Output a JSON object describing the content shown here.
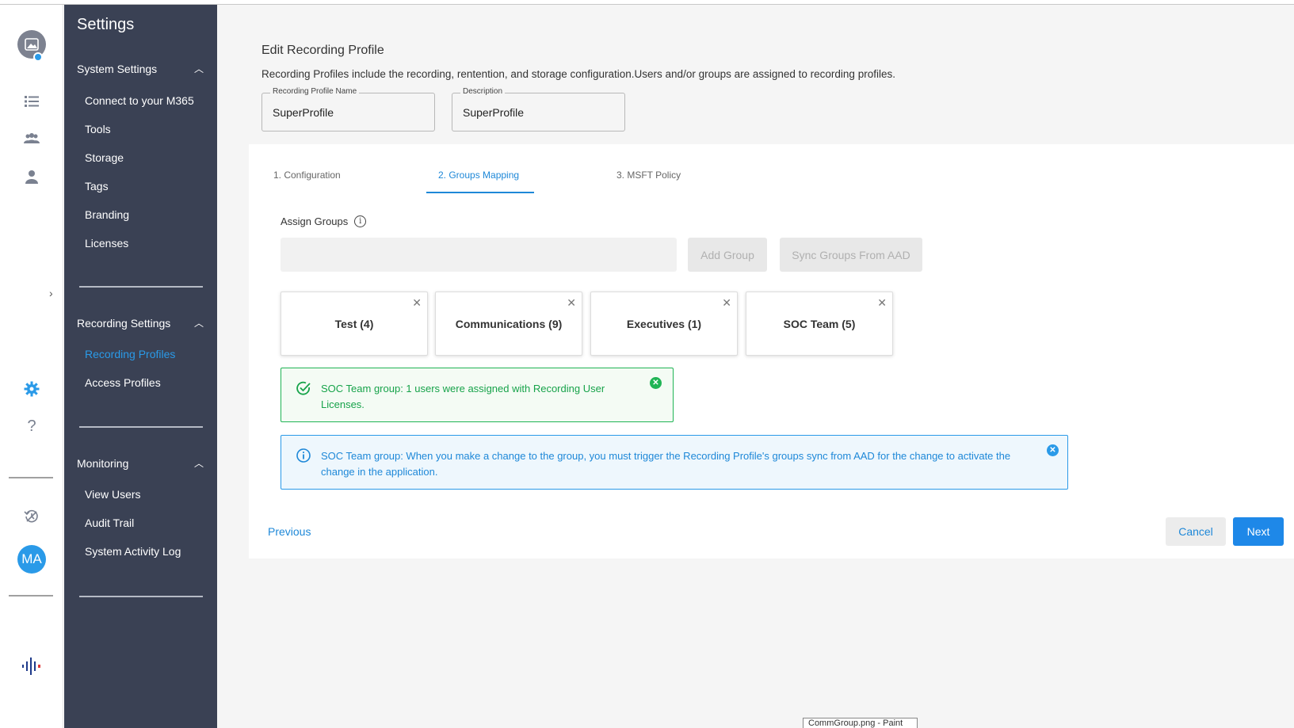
{
  "sidebar": {
    "title": "Settings",
    "sections": [
      {
        "label": "System Settings",
        "items": [
          "Connect to your M365",
          "Tools",
          "Storage",
          "Tags",
          "Branding",
          "Licenses"
        ]
      },
      {
        "label": "Recording Settings",
        "items": [
          "Recording Profiles",
          "Access Profiles"
        ]
      },
      {
        "label": "Monitoring",
        "items": [
          "View Users",
          "Audit Trail",
          "System Activity Log"
        ]
      }
    ],
    "active_item": "Recording Profiles"
  },
  "rail": {
    "avatar_initials": "MA",
    "help": "?"
  },
  "page": {
    "title": "Edit Recording Profile",
    "description": "Recording Profiles include the recording, rentention, and storage configuration.Users and/or groups are assigned to recording profiles.",
    "fields": {
      "name_label": "Recording Profile Name",
      "name_value": "SuperProfile",
      "desc_label": "Description",
      "desc_value": "SuperProfile"
    }
  },
  "tabs": [
    {
      "label": "1. Configuration",
      "active": false
    },
    {
      "label": "2. Groups Mapping",
      "active": true
    },
    {
      "label": "3. MSFT Policy",
      "active": false
    }
  ],
  "assign": {
    "label": "Assign Groups",
    "add_button": "Add Group",
    "sync_button": "Sync Groups From AAD"
  },
  "groups": [
    "Test (4)",
    "Communications (9)",
    "Executives (1)",
    "SOC Team (5)"
  ],
  "alerts": {
    "success": "SOC Team group: 1 users were assigned with Recording User Licenses.",
    "info": "SOC Team group: When you make a change to the group, you must trigger the Recording Profile's groups sync from AAD for the change to activate the change in the application."
  },
  "footer": {
    "previous": "Previous",
    "cancel": "Cancel",
    "next": "Next"
  },
  "taskbar_tip": "CommGroup.png - Paint",
  "colors": {
    "accent": "#1e88e8",
    "sidebar": "#3a4154",
    "success": "#20b455",
    "info": "#2a9ae8"
  }
}
